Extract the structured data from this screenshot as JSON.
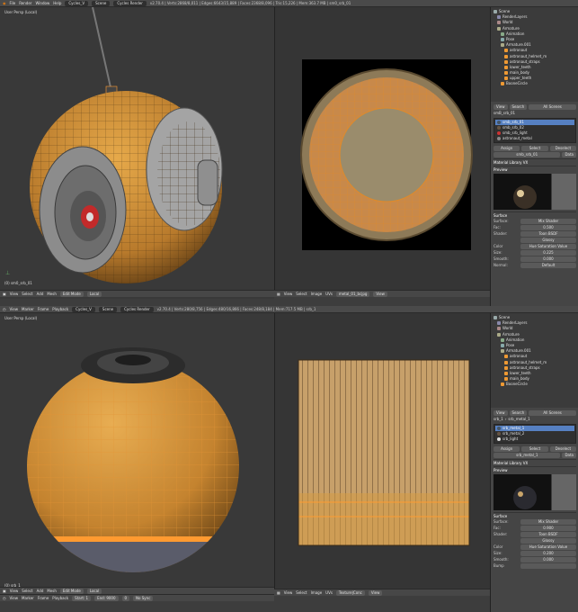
{
  "top": {
    "menus": [
      "File",
      "Render",
      "Window",
      "Help"
    ],
    "layout": "Cycles_V",
    "scene": "Scene",
    "engine": "Cycles Render",
    "stats": "v2.70.4 | Verts:2868/8,011 | Edges:6643/15,889 | Faces:2368/8,096 | Tris:15,226 | Mem:363.7 MB | sm0_srb_01"
  },
  "bottom_top": {
    "menus": [
      "View",
      "Marker",
      "Frame",
      "Playback"
    ],
    "layout": "Cycles_V",
    "scene": "Scene",
    "engine": "Cycles Render",
    "sync": "No Sync",
    "start": "Start: 1",
    "end": "End: 9000",
    "frame": "0",
    "keying": "bpgNuturo",
    "stats": "v2.70.4 | Verts:280/8,756 | Edges:480/16,866 | Faces:248/8,184 | Mem:717.5 MB | srb_1"
  },
  "viewport1": {
    "label": "User Persp (Local)",
    "object": "(0) sm0_srb_01",
    "header": [
      "View",
      "Select",
      "Add",
      "Mesh",
      "Edit Mode",
      "Local"
    ],
    "uv_header": [
      "View",
      "Select",
      "Image",
      "UVs",
      "metal_01_bcjpg"
    ],
    "uv_view": "View"
  },
  "viewport2": {
    "label": "User Persp (Local)",
    "object": "(0) srb_1",
    "header": [
      "View",
      "Select",
      "Add",
      "Mesh",
      "Edit Mode",
      "Local"
    ],
    "uv_header": [
      "View",
      "Select",
      "Image",
      "UVs",
      "Texture|Conc"
    ],
    "uv_view": "View",
    "timeline": [
      "View",
      "Marker",
      "Frame",
      "Playback",
      "Start: 1",
      "End: 9000",
      "0",
      "No Sync"
    ]
  },
  "outliner1": [
    "Scene",
    "RenderLayers",
    "World",
    "Armature",
    "Animation",
    "Pose",
    "Armature.001",
    "astronaut",
    "astronaut_helmet_m",
    "astronaut_straps",
    "lower_teeth",
    "main_body",
    "upper_teeth",
    "BooneCircle"
  ],
  "outliner2": [
    "Scene",
    "RenderLayers",
    "World",
    "Armature",
    "Animation",
    "Pose",
    "Armature.001",
    "astronaut",
    "astronaut_helmet_m",
    "astronaut_straps",
    "lower_teeth",
    "main_body",
    "BooneCircle"
  ],
  "props1": {
    "tabs": [
      "View",
      "Search",
      "All Scenes"
    ],
    "path": "smB_srb_01",
    "materials": [
      "smb_srb_01",
      "smb_srb_02",
      "smb_srb_light",
      "astronaut_metal"
    ],
    "assign": "Assign",
    "select": "Select",
    "deselect": "Deselect",
    "mat_name": "smb_srb_01",
    "data": "Data",
    "library": "Material Library VX",
    "preview": "Preview",
    "surface_section": "Surface",
    "surface": "Mix Shader",
    "fac_label": "Fac:",
    "fac": "0.500",
    "shader_label": "Shader:",
    "shader": "Toon BSDF",
    "glossy": "Glossy",
    "color_label": "Color",
    "color_val": "Hue Saturation Value",
    "size_label": "Size:",
    "size": "0.225",
    "smooth_label": "Smooth:",
    "smooth": "0.000",
    "normal_label": "Normal:",
    "normal": "Default"
  },
  "props2": {
    "tabs": [
      "View",
      "Search",
      "All Scenes"
    ],
    "path": "srb_1",
    "path2": "srb_metal_1",
    "materials": [
      "srb_metal_1",
      "srb_metal_2",
      "srb_light"
    ],
    "assign": "Assign",
    "select": "Select",
    "deselect": "Deselect",
    "mat_name": "srb_metal_1",
    "data": "Data",
    "library": "Material Library VX",
    "preview": "Preview",
    "surface_section": "Surface",
    "surface": "Mix Shader",
    "fac_label": "Fac:",
    "fac": "0.900",
    "shader_label": "Shader:",
    "shader": "Toon BSDF",
    "glossy": "Glossy",
    "color_label": "Color",
    "color_val": "Hue Saturation Value",
    "size_label": "Size:",
    "size": "0.200",
    "smooth_label": "Smooth:",
    "smooth": "0.000",
    "normal_label": "Bump",
    "normal": ""
  },
  "colors": {
    "orange": "#d28c32",
    "select": "#5680c2",
    "panel": "#454545"
  }
}
